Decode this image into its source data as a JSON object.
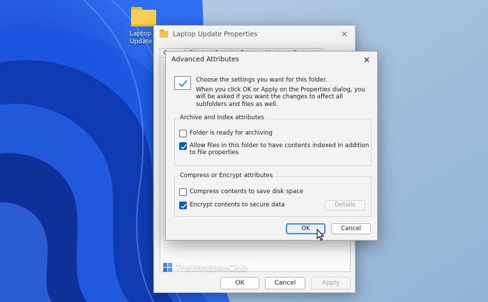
{
  "desktop": {
    "icon_label": "Laptop\nUpdate",
    "icon": "folder-icon"
  },
  "properties_window": {
    "title": "Laptop Update Properties",
    "close_glyph": "✕",
    "tabs": [
      "General",
      "Sharing",
      "Security",
      "Previous Versions",
      "Customize"
    ],
    "buttons": {
      "ok": "OK",
      "cancel": "Cancel",
      "apply": "Apply"
    }
  },
  "advanced_dialog": {
    "title": "Advanced Attributes",
    "close_glyph": "✕",
    "intro_line1": "Choose the settings you want for this folder.",
    "intro_line2": "When you click OK or Apply on the Properties dialog, you will be asked if you want the changes to affect all subfolders and files as well.",
    "archive_group": {
      "label": "Archive and Index attributes",
      "options": [
        {
          "label": "Folder is ready for archiving",
          "checked": false
        },
        {
          "label": "Allow files in this folder to have contents indexed in addition to file properties",
          "checked": true
        }
      ]
    },
    "compress_group": {
      "label": "Compress or Encrypt attributes",
      "options": [
        {
          "label": "Compress contents to save disk space",
          "checked": false
        },
        {
          "label": "Encrypt contents to secure data",
          "checked": true
        }
      ],
      "details_button": "Details"
    },
    "buttons": {
      "ok": "OK",
      "cancel": "Cancel"
    }
  },
  "watermark": {
    "text": "TheWindowsClub"
  },
  "colors": {
    "accent": "#005fb8",
    "wallpaper": "#a7c1dc",
    "folder": "#f7cf52"
  }
}
